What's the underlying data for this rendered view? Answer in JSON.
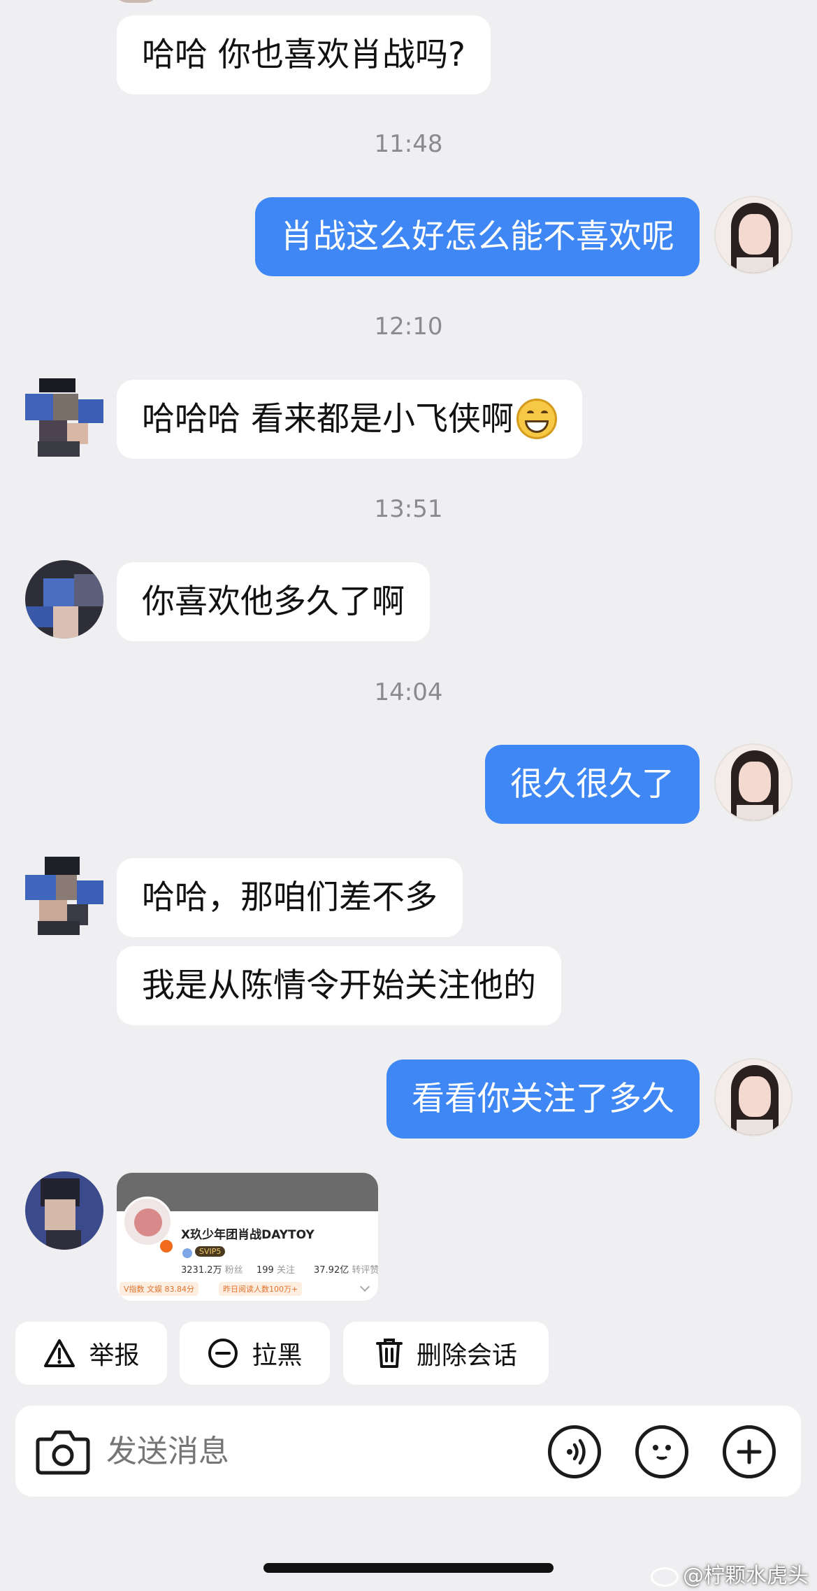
{
  "messages": {
    "m1": "哈哈 你也喜欢肖战吗?",
    "t1": "11:48",
    "m2": "肖战这么好怎么能不喜欢呢",
    "t2": "12:10",
    "m3": "哈哈哈 看来都是小飞侠啊",
    "t3": "13:51",
    "m4": "你喜欢他多久了啊",
    "t4": "14:04",
    "m5": "很久很久了",
    "m6": "哈哈，那咱们差不多",
    "m7": "我是从陈情令开始关注他的",
    "m8": "看看你关注了多久"
  },
  "card": {
    "name": "X玖少年团肖战DAYTOY",
    "vip_badge": "SVIP5",
    "fans_count": "3231.2万",
    "fans_label": "粉丝",
    "follow_count": "199",
    "follow_label": "关注",
    "repost_count": "37.92亿",
    "repost_label": "转评赞",
    "tag1": "V指数 文娱 83.84分",
    "tag2": "昨日阅读人数100万+"
  },
  "actions": {
    "report": "举报",
    "block": "拉黑",
    "delete": "删除会话"
  },
  "input": {
    "placeholder": "发送消息"
  },
  "watermark": "@柠颗水虎头",
  "colors": {
    "outgoing_bubble": "#3f87f5",
    "background": "#efeff1"
  }
}
